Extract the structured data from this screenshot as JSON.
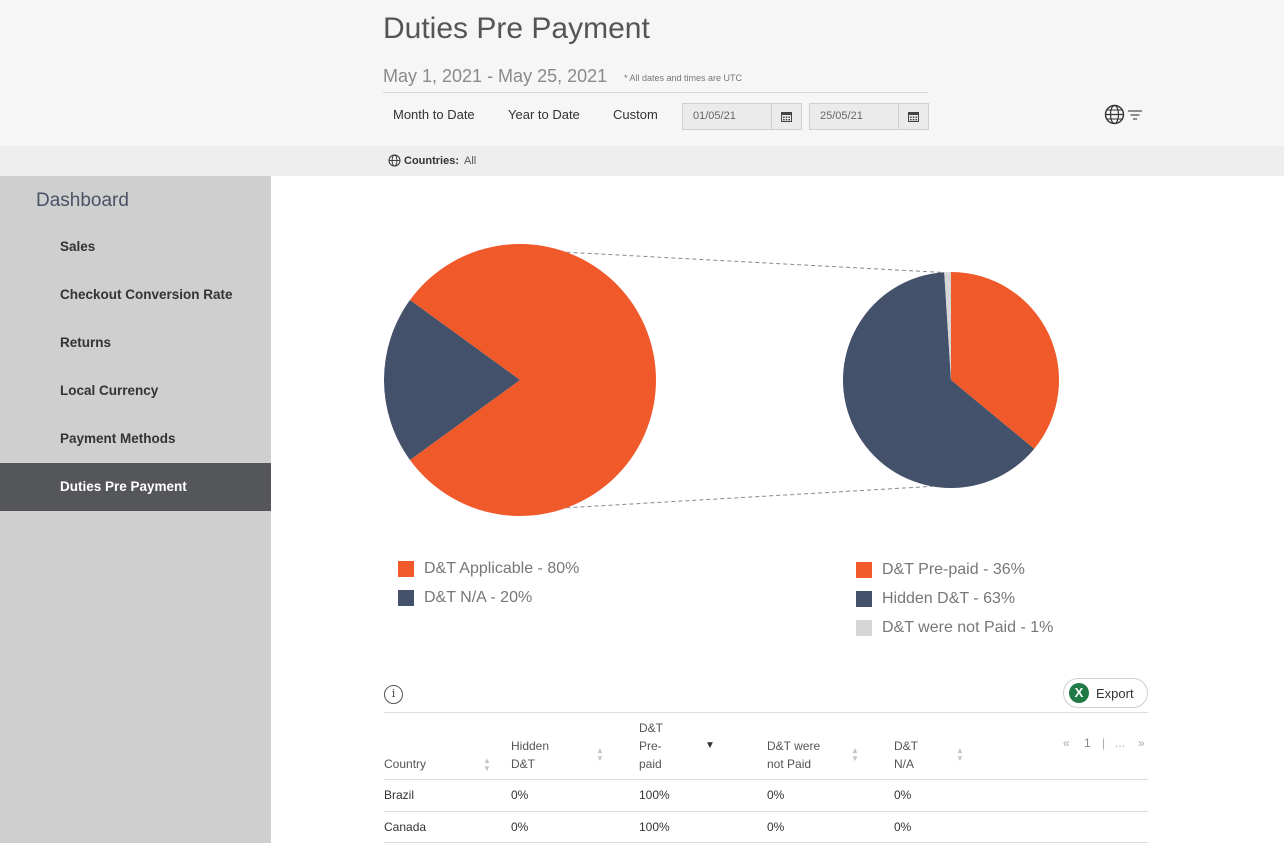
{
  "header": {
    "title": "Duties Pre Payment",
    "date_range": "May 1, 2021 - May 25, 2021",
    "utc_note": "* All dates and times are UTC",
    "range_buttons": [
      "Month to Date",
      "Year to Date",
      "Custom"
    ],
    "start_date": "01/05/21",
    "end_date": "25/05/21"
  },
  "filter": {
    "label": "Countries:",
    "value": "All"
  },
  "sidebar": {
    "heading": "Dashboard",
    "items": [
      {
        "label": "Sales"
      },
      {
        "label": "Checkout Conversion Rate"
      },
      {
        "label": "Returns"
      },
      {
        "label": "Local Currency"
      },
      {
        "label": "Payment Methods"
      },
      {
        "label": "Duties Pre Payment"
      }
    ],
    "active_index": 5
  },
  "chart_data": [
    {
      "type": "pie",
      "slices": [
        {
          "label": "D&T Applicable - 80%",
          "value": 80,
          "color": "#f05a2b"
        },
        {
          "label": "D&T N/A - 20%",
          "value": 20,
          "color": "#44516a"
        }
      ]
    },
    {
      "type": "pie",
      "slices": [
        {
          "label": "D&T Pre-paid - 36%",
          "value": 36,
          "color": "#f05a2b"
        },
        {
          "label": "Hidden D&T - 63%",
          "value": 63,
          "color": "#44516a"
        },
        {
          "label": "D&T were not Paid - 1%",
          "value": 1,
          "color": "#d6d6d6"
        }
      ]
    }
  ],
  "table": {
    "export_label": "Export",
    "info_icon": "i",
    "columns": [
      {
        "label": "Country"
      },
      {
        "label": "Hidden D&T"
      },
      {
        "label": "D&T Pre- paid"
      },
      {
        "label": "D&T were not Paid"
      },
      {
        "label": "D&T N/A"
      }
    ],
    "pager": {
      "prev": "«",
      "page": "1",
      "sep": "|",
      "ellipsis": "...",
      "next": "»"
    },
    "rows": [
      [
        "Brazil",
        "0%",
        "100%",
        "0%",
        "0%"
      ],
      [
        "Canada",
        "0%",
        "100%",
        "0%",
        "0%"
      ]
    ]
  },
  "colors": {
    "accent": "#f05a2b",
    "slate": "#44516a",
    "grey": "#d6d6d6",
    "sidebar_active": "#545659"
  }
}
